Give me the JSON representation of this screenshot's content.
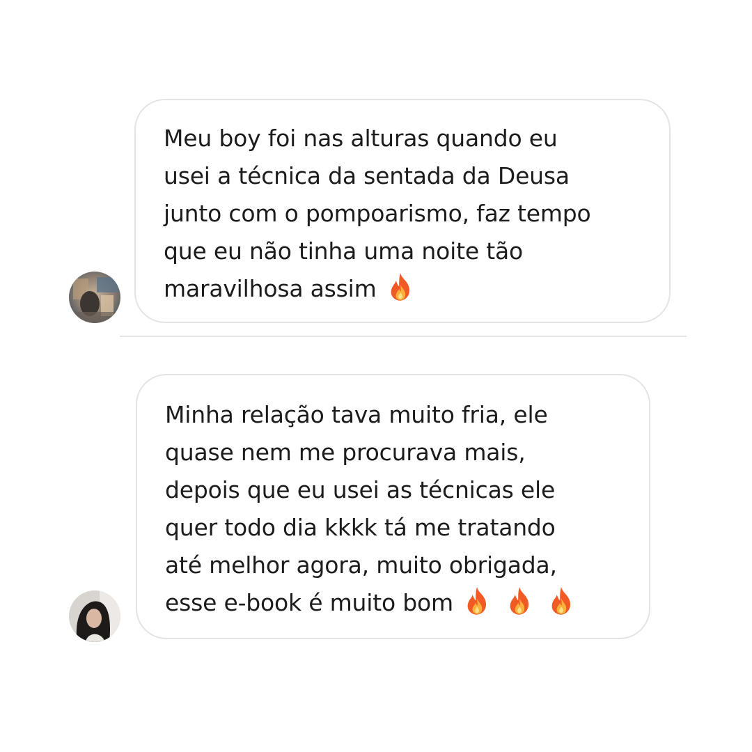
{
  "thread": {
    "messages": [
      {
        "avatar_icon": "profile-photo-1",
        "lines": [
          "Meu boy foi nas alturas quando eu",
          "usei a técnica da sentada da Deusa",
          "junto com o pompoarismo, faz tempo",
          "que eu não tinha uma noite tão",
          "maravilhosa assim"
        ],
        "emoji_icon": "fire-emoji",
        "emoji_count": 1
      },
      {
        "avatar_icon": "profile-photo-2",
        "lines": [
          "Minha relação tava muito fria, ele",
          "quase nem me procurava mais,",
          "depois que eu usei as técnicas ele",
          "quer todo dia kkkk tá me tratando",
          "até melhor agora, muito obrigada,",
          "esse e-book é muito bom"
        ],
        "emoji_icon": "fire-emoji",
        "emoji_count": 3
      }
    ]
  },
  "colors": {
    "background": "#ffffff",
    "bubble_border": "#e4e4e4",
    "divider": "#e6e6e6",
    "text": "#1c1c1c",
    "fire_outer": "#f15a24",
    "fire_inner": "#fbb03b"
  }
}
